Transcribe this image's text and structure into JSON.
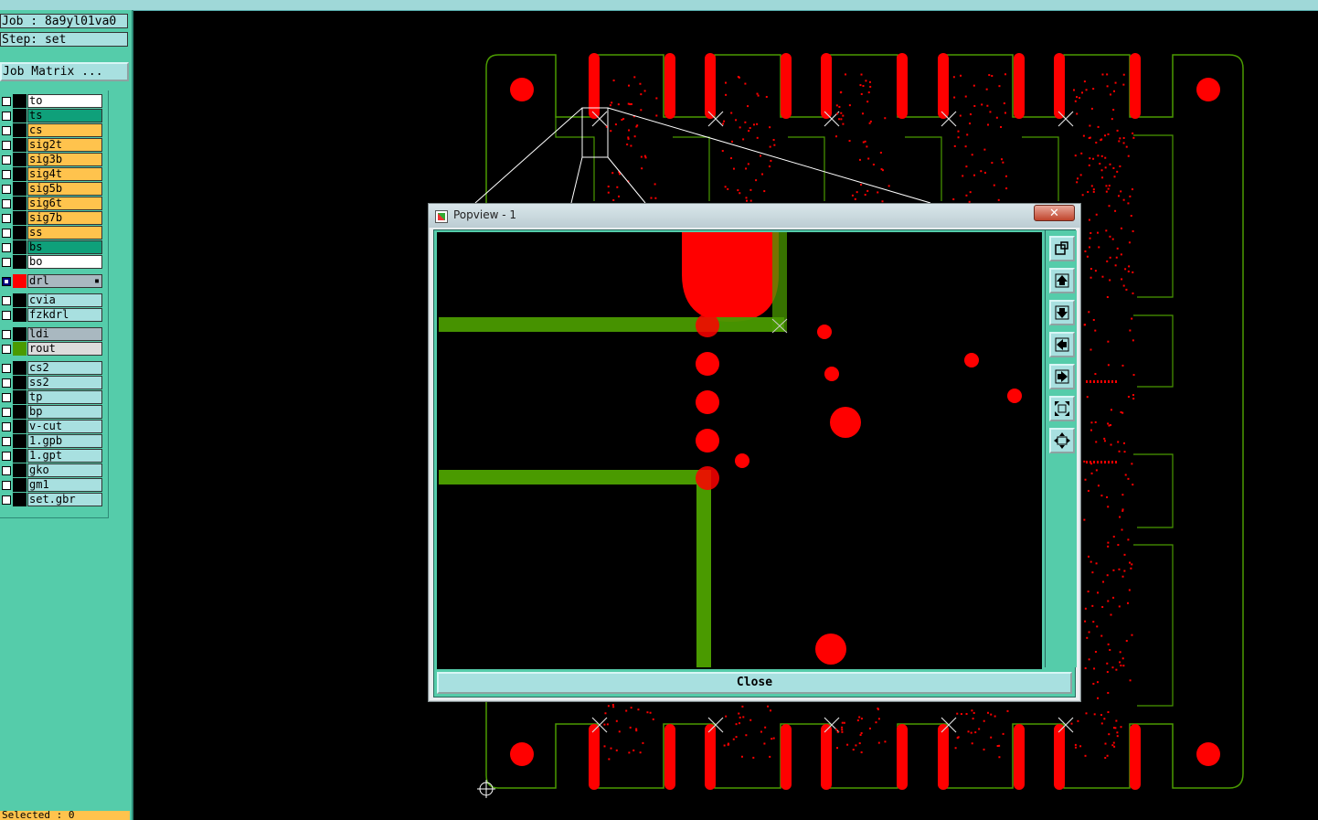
{
  "header": {
    "job_label": "Job : 8a9yl01va0",
    "step_label": "Step: set",
    "matrix_button": "Job Matrix ..."
  },
  "layers": [
    {
      "name": "to",
      "bg": "#ffffff",
      "color": "#000000"
    },
    {
      "name": "ts",
      "bg": "#0fa07a",
      "color": "#000000"
    },
    {
      "name": "cs",
      "bg": "#ffc34d",
      "color": "#000000"
    },
    {
      "name": "sig2t",
      "bg": "#ffc34d",
      "color": "#000000"
    },
    {
      "name": "sig3b",
      "bg": "#ffc34d",
      "color": "#000000"
    },
    {
      "name": "sig4t",
      "bg": "#ffc34d",
      "color": "#000000"
    },
    {
      "name": "sig5b",
      "bg": "#ffc34d",
      "color": "#000000"
    },
    {
      "name": "sig6t",
      "bg": "#ffc34d",
      "color": "#000000"
    },
    {
      "name": "sig7b",
      "bg": "#ffc34d",
      "color": "#000000"
    },
    {
      "name": "ss",
      "bg": "#ffc34d",
      "color": "#000000"
    },
    {
      "name": "bs",
      "bg": "#0fa07a",
      "color": "#000000"
    },
    {
      "name": "bo",
      "bg": "#ffffff",
      "color": "#000000"
    },
    {
      "name": "drl",
      "bg": "#a9b8c0",
      "color": "#ff0000",
      "active": true
    },
    {
      "name": "cvia",
      "bg": "#a8e0e0",
      "color": "#000000"
    },
    {
      "name": "fzkdrl",
      "bg": "#a8e0e0",
      "color": "#000000"
    },
    {
      "name": "ldi",
      "bg": "#a9b8c0",
      "color": "#000000"
    },
    {
      "name": "rout",
      "bg": "#dcdcdc",
      "color": "#4a9a00"
    },
    {
      "name": "cs2",
      "bg": "#a8e0e0",
      "color": "#000000"
    },
    {
      "name": "ss2",
      "bg": "#a8e0e0",
      "color": "#000000"
    },
    {
      "name": "tp",
      "bg": "#a8e0e0",
      "color": "#000000"
    },
    {
      "name": "bp",
      "bg": "#a8e0e0",
      "color": "#000000"
    },
    {
      "name": "v-cut",
      "bg": "#a8e0e0",
      "color": "#000000"
    },
    {
      "name": "1.gpb",
      "bg": "#a8e0e0",
      "color": "#000000"
    },
    {
      "name": "1.gpt",
      "bg": "#a8e0e0",
      "color": "#000000"
    },
    {
      "name": "gko",
      "bg": "#a8e0e0",
      "color": "#000000"
    },
    {
      "name": "gm1",
      "bg": "#a8e0e0",
      "color": "#000000"
    },
    {
      "name": "set.gbr",
      "bg": "#a8e0e0",
      "color": "#000000"
    }
  ],
  "status": {
    "selected": "Selected : 0"
  },
  "popup": {
    "title": "Popview - 1",
    "close_glyph": "✕",
    "close_button": "Close"
  },
  "colors": {
    "copper": "#ff0000",
    "rout": "#4a9a00",
    "background": "#000000",
    "panel": "#55ccaa"
  },
  "tool_icons": [
    "zoom-window-icon",
    "pan-up-icon",
    "pan-down-icon",
    "pan-left-icon",
    "pan-right-icon",
    "zoom-fit-icon",
    "zoom-home-icon"
  ]
}
